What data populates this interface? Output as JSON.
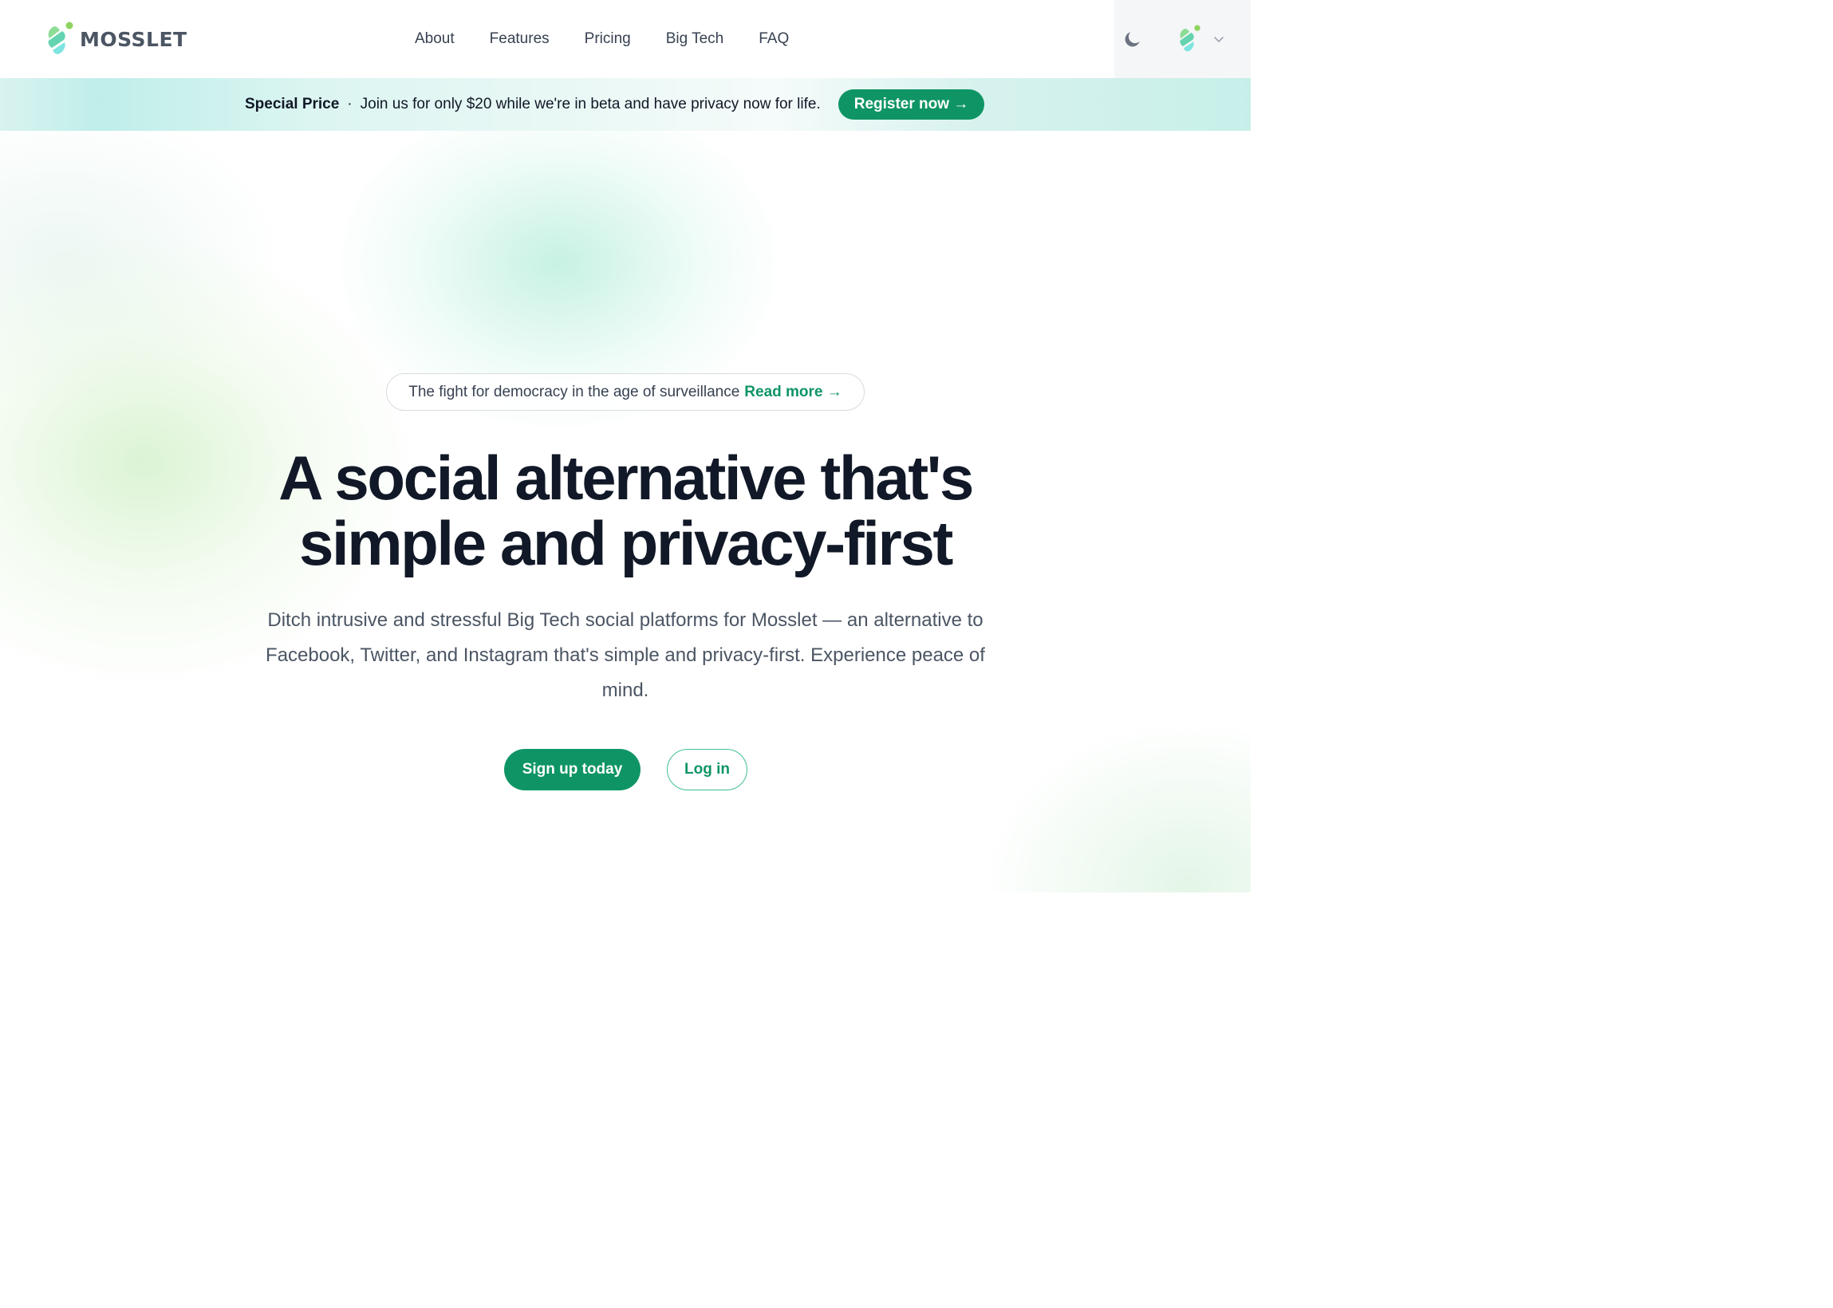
{
  "brand": {
    "name": "MOSSLET",
    "logo_icon": "mosslet-leaf-icon"
  },
  "nav": {
    "items": [
      {
        "label": "About"
      },
      {
        "label": "Features"
      },
      {
        "label": "Pricing"
      },
      {
        "label": "Big Tech"
      },
      {
        "label": "FAQ"
      }
    ]
  },
  "header_actions": {
    "theme_toggle_icon": "moon-icon",
    "account_avatar_icon": "mosslet-leaf-icon",
    "dropdown_icon": "chevron-down-icon"
  },
  "banner": {
    "title": "Special Price",
    "separator": "·",
    "message": "Join us for only $20 while we're in beta and have privacy now for life.",
    "cta_label": "Register now →"
  },
  "hero": {
    "announcement_text": "The fight for democracy in the age of surveillance",
    "announcement_link": "Read more →",
    "headline_line1": "A social alternative that's",
    "headline_line2": "simple and privacy-first",
    "subtext": "Ditch intrusive and stressful Big Tech social platforms for Mosslet — an alternative to Facebook, Twitter, and Instagram that's simple and privacy-first. Experience peace of mind.",
    "primary_cta": "Sign up today",
    "secondary_cta": "Log in"
  },
  "colors": {
    "accent": "#0f9565",
    "text_dark": "#111827",
    "text_muted": "#4b5563",
    "banner_bg": "#d9f3ef"
  }
}
